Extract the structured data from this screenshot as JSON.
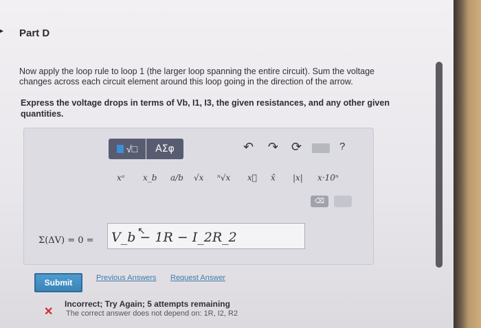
{
  "part": {
    "marker": "▸",
    "title": "Part D"
  },
  "instructions": "Now apply the loop rule to loop 1 (the larger loop spanning the entire circuit). Sum the voltage changes across each circuit element around this loop going in the direction of the arrow.",
  "express": "Express the voltage drops in terms of Vb, I1, I3, the given resistances, and any other given quantities.",
  "toolbar": {
    "format_label": "√□",
    "greek_label": "ΑΣφ",
    "undo_icon": "↶",
    "redo_icon": "↷",
    "reset_icon": "⟳",
    "help_label": "?"
  },
  "templates": [
    "xᵃ",
    "x_b",
    "a/b",
    "√x",
    "ⁿ√x",
    "x⃗",
    "x̂",
    "|x|",
    "x·10ⁿ"
  ],
  "answer": {
    "lhs": "Σ(ΔV) = 0 =",
    "expression": "V_b − 1R − I_2R_2"
  },
  "buttons": {
    "submit": "Submit",
    "previous_answers": "Previous Answers",
    "request_answer": "Request Answer"
  },
  "feedback": {
    "icon": "✕",
    "status": "Incorrect; Try Again; 5 attempts remaining",
    "note": "The correct answer does not depend on: 1R, I2, R2"
  },
  "colors": {
    "accent": "#3b83b8",
    "error": "#d02a2a",
    "toolbar": "#585c70"
  }
}
